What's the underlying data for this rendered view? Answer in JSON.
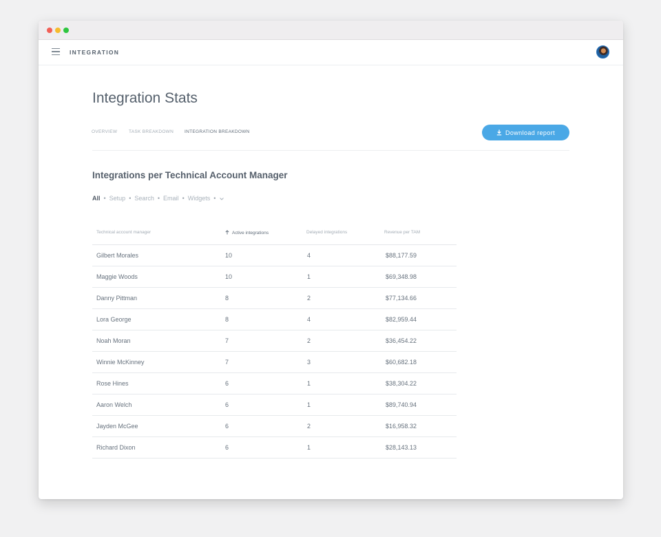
{
  "app": {
    "title": "INTEGRATION",
    "accent_color": "#4aa8e6"
  },
  "page": {
    "title": "Integration Stats",
    "tabs": [
      {
        "label": "OVERVIEW",
        "active": false
      },
      {
        "label": "TASK BREAKDOWN",
        "active": false
      },
      {
        "label": "INTEGRATION BREAKDOWN",
        "active": true
      }
    ],
    "download_button": {
      "label": "Download report",
      "icon": "download-icon"
    }
  },
  "section": {
    "title": "Integrations per Technical Account Manager",
    "filters": [
      {
        "label": "All",
        "active": true
      },
      {
        "label": "Setup",
        "active": false
      },
      {
        "label": "Search",
        "active": false
      },
      {
        "label": "Email",
        "active": false
      },
      {
        "label": "Widgets",
        "active": false
      }
    ],
    "more_icon": "chevron-down-icon"
  },
  "table": {
    "columns": [
      {
        "label": "Technical account manager"
      },
      {
        "label": "Active integrations",
        "sorted": true,
        "sort_icon": "arrow-up-icon"
      },
      {
        "label": "Delayed integrations"
      },
      {
        "label": "Revenue per TAM"
      }
    ],
    "rows": [
      {
        "name": "Gilbert Morales",
        "active": "10",
        "delayed": "4",
        "revenue": "$88,177.59"
      },
      {
        "name": "Maggie Woods",
        "active": "10",
        "delayed": "1",
        "revenue": "$69,348.98"
      },
      {
        "name": "Danny Pittman",
        "active": "8",
        "delayed": "2",
        "revenue": "$77,134.66"
      },
      {
        "name": "Lora George",
        "active": "8",
        "delayed": "4",
        "revenue": "$82,959.44"
      },
      {
        "name": "Noah Moran",
        "active": "7",
        "delayed": "2",
        "revenue": "$36,454.22"
      },
      {
        "name": "Winnie McKinney",
        "active": "7",
        "delayed": "3",
        "revenue": "$60,682.18"
      },
      {
        "name": "Rose Hines",
        "active": "6",
        "delayed": "1",
        "revenue": "$38,304.22"
      },
      {
        "name": "Aaron Welch",
        "active": "6",
        "delayed": "1",
        "revenue": "$89,740.94"
      },
      {
        "name": "Jayden McGee",
        "active": "6",
        "delayed": "2",
        "revenue": "$16,958.32"
      },
      {
        "name": "Richard Dixon",
        "active": "6",
        "delayed": "1",
        "revenue": "$28,143.13"
      }
    ]
  }
}
